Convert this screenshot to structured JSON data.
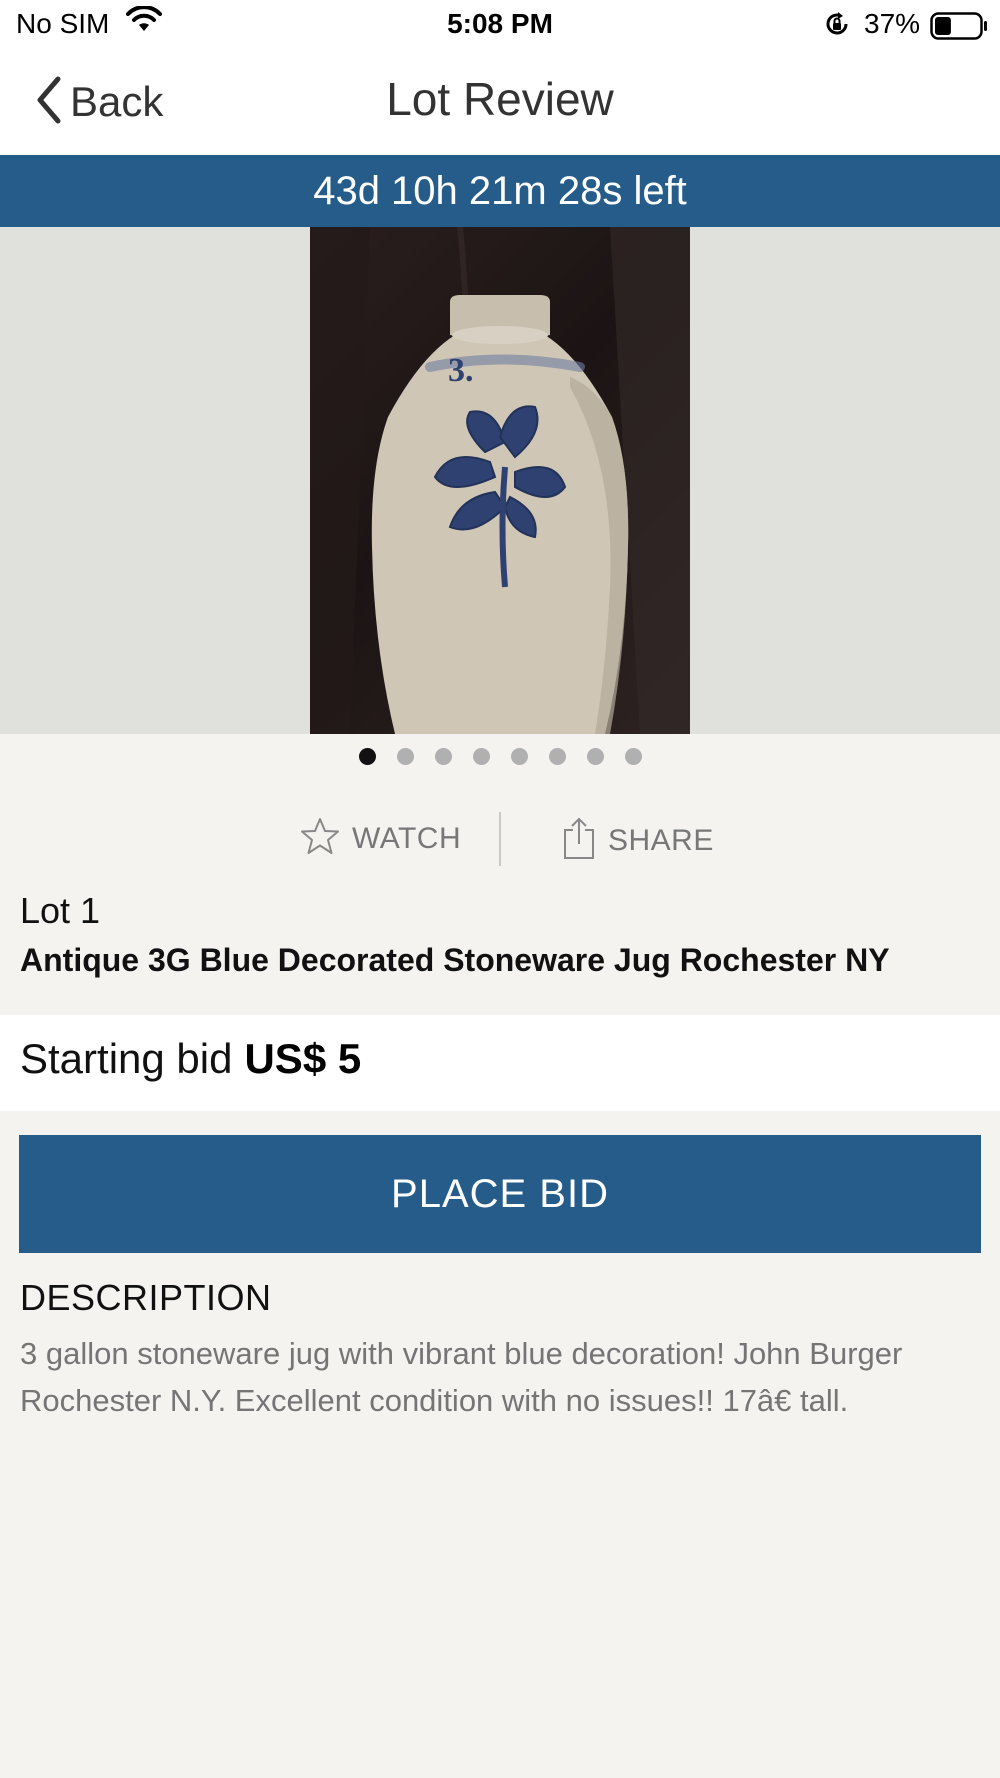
{
  "status_bar": {
    "carrier": "No SIM",
    "time": "5:08 PM",
    "battery_percent": "37%",
    "battery_level": 0.37
  },
  "nav": {
    "back_label": "Back",
    "title": "Lot Review"
  },
  "timer": {
    "text": "43d 10h 21m 28s left"
  },
  "gallery": {
    "image_count": 8,
    "active_index": 0,
    "jug_mark": "3."
  },
  "actions": {
    "watch_label": "WATCH",
    "share_label": "SHARE"
  },
  "lot": {
    "number_label": "Lot 1",
    "title": "Antique 3G Blue Decorated Stoneware Jug Rochester NY"
  },
  "bid": {
    "label": "Starting bid",
    "amount": "US$ 5",
    "button_label": "PLACE BID"
  },
  "description": {
    "heading": "DESCRIPTION",
    "text": "3 gallon stoneware jug with vibrant blue decoration! John Burger Rochester N.Y. Excellent condition with no issues!! 17â€ tall."
  },
  "colors": {
    "accent": "#255c8a",
    "background": "#f4f3f0",
    "muted_text": "#757575"
  }
}
